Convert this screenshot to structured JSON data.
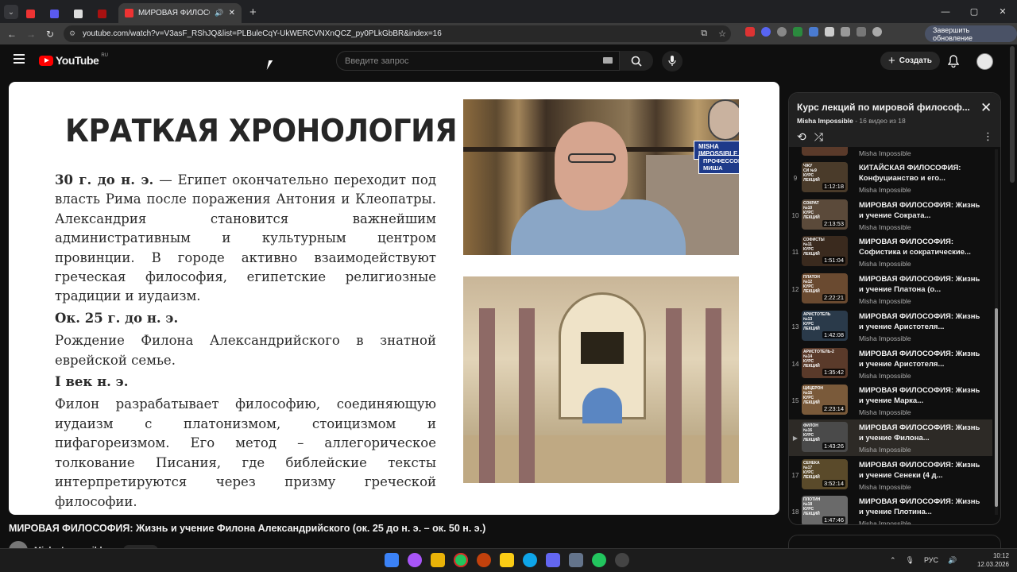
{
  "browser": {
    "active_tab_title": "МИРОВАЯ ФИЛОСОФИЯ: Ж",
    "url": "youtube.com/watch?v=V3asF_RShJQ&list=PLBuleCqY-UkWERCVNXnQCZ_py0PLkGbBR&index=16",
    "update_button": "Завершить обновление",
    "new_tab": "+",
    "win_min": "—",
    "win_max": "▢",
    "win_close": "✕"
  },
  "youtube": {
    "logo_text": "YouTube",
    "logo_country": "RU",
    "search_placeholder": "Введите запрос",
    "create_label": "Создать"
  },
  "slide": {
    "title": "КРАТКАЯ ХРОНОЛОГИЯ",
    "p1": "30 г. до н. э. — Египет окончательно переходит под власть Рима после поражения Антония и Клеопатры. Александрия становится важнейшим административным и культурным центром провинции. В городе активно взаимодействуют греческая философия, египетские религиозные традиции и иудаизм.",
    "p1_bold": "30 г. до н. э.",
    "p1_rest": " — Египет окончательно переходит под власть Рима после поражения Антония и Клеопатры. Александрия становится важнейшим административным и культурным центром провинции. В городе активно взаимодействуют греческая философия, египетские религиозные традиции и иудаизм.",
    "h2": "Ок. 25 г. до н. э.",
    "p2": "Рождение Филона Александрийского в знатной еврейской семье.",
    "h3": "I век н. э.",
    "p3": "Филон разрабатывает философию, соединяющую иудаизм с платонизмом, стоицизмом и пифагореизмом. Его метод – аллегорическое толкование Писания, где библейские тексты интерпретируются через призму греческой философии.",
    "brand1": "MISHA IMPOSSIBLE",
    "brand2": "ПРОФЕССОР МИША"
  },
  "video": {
    "title": "МИРОВАЯ ФИЛОСОФИЯ: Жизнь и учение Филона Александрийского (ок. 25 до н. э. – ок. 50 н. э.)",
    "channel": "Misha Impossible"
  },
  "playlist": {
    "title": "Курс лекций по мировой философ...",
    "channel": "Misha Impossible",
    "position": " - 16 видео из 18",
    "top_partial_channel": "Misha Impossible",
    "items": [
      {
        "index": "9",
        "title": "КИТАЙСКАЯ ФИЛОСОФИЯ: Конфуцианство и его...",
        "channel": "Misha Impossible",
        "duration": "1:12:18",
        "thumb_label": "ЧЖУ СИ №9 КУРС ЛЕКЦИЙ"
      },
      {
        "index": "10",
        "title": "МИРОВАЯ ФИЛОСОФИЯ: Жизнь и учение Сократа...",
        "channel": "Misha Impossible",
        "duration": "2:13:53",
        "thumb_label": "СОКРАТ №10 КУРС ЛЕКЦИЙ"
      },
      {
        "index": "11",
        "title": "МИРОВАЯ ФИЛОСОФИЯ: Софистика и сократические...",
        "channel": "Misha Impossible",
        "duration": "1:51:04",
        "thumb_label": "СОФИСТЫ №11 КУРС ЛЕКЦИЙ"
      },
      {
        "index": "12",
        "title": "МИРОВАЯ ФИЛОСОФИЯ: Жизнь и учение Платона (о...",
        "channel": "Misha Impossible",
        "duration": "2:22:21",
        "thumb_label": "ПЛАТОН №12 КУРС ЛЕКЦИЙ"
      },
      {
        "index": "13",
        "title": "МИРОВАЯ ФИЛОСОФИЯ: Жизнь и учение Аристотеля...",
        "channel": "Misha Impossible",
        "duration": "1:42:08",
        "thumb_label": "АРИСТОТЕЛЬ №13 КУРС ЛЕКЦИЙ"
      },
      {
        "index": "14",
        "title": "МИРОВАЯ ФИЛОСОФИЯ: Жизнь и учение Аристотеля...",
        "channel": "Misha Impossible",
        "duration": "1:35:42",
        "thumb_label": "АРИСТОТЕЛЬ-2 №14 КУРС ЛЕКЦИЙ"
      },
      {
        "index": "15",
        "title": "МИРОВАЯ ФИЛОСОФИЯ: Жизнь и учение Марка...",
        "channel": "Misha Impossible",
        "duration": "2:23:14",
        "thumb_label": "ЦИЦЕРОН №15 КУРС ЛЕКЦИЙ"
      },
      {
        "index": "▶",
        "title": "МИРОВАЯ ФИЛОСОФИЯ: Жизнь и учение Филона...",
        "channel": "Misha Impossible",
        "duration": "1:43:26",
        "thumb_label": "ФИЛОН №16 КУРС ЛЕКЦИЙ"
      },
      {
        "index": "17",
        "title": "МИРОВАЯ ФИЛОСОФИЯ: Жизнь и учение Сенеки (4 д...",
        "channel": "Misha Impossible",
        "duration": "3:52:14",
        "thumb_label": "СЕНЕКА №17 КУРС ЛЕКЦИЙ"
      },
      {
        "index": "18",
        "title": "МИРОВАЯ ФИЛОСОФИЯ: Жизнь и учение Плотина...",
        "channel": "Misha Impossible",
        "duration": "1:47:46",
        "thumb_label": "ПЛОТИН №18 КУРС ЛЕКЦИЙ"
      }
    ]
  },
  "taskbar": {
    "lang": "РУС",
    "time": "10:12",
    "date": "12.03.2026"
  },
  "colors": {
    "youtube_red": "#ff0000",
    "now_playing_bg": "#2d2a26",
    "brand_blue": "#1e3a8a"
  }
}
